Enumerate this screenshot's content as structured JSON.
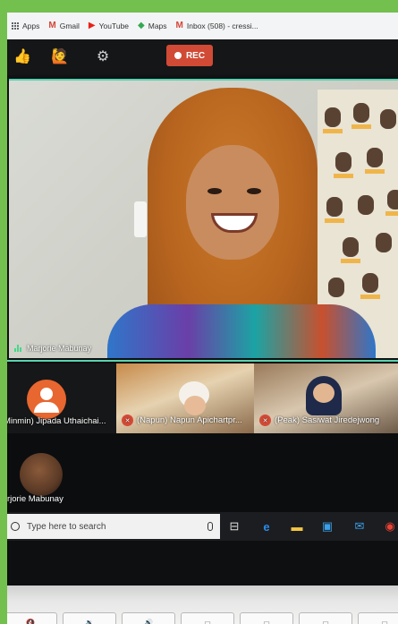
{
  "bookmarks": {
    "apps_label": "Apps",
    "items": [
      {
        "label": "Gmail",
        "icon": "gmail-icon",
        "glyph": "M",
        "color": "#d44638"
      },
      {
        "label": "YouTube",
        "icon": "youtube-icon",
        "glyph": "▶",
        "color": "#e62117"
      },
      {
        "label": "Maps",
        "icon": "maps-icon",
        "glyph": "◆",
        "color": "#34a853"
      },
      {
        "label": "Inbox (508) - cressi...",
        "icon": "gmail-icon",
        "glyph": "M",
        "color": "#d44638"
      }
    ]
  },
  "toolbar": {
    "rec_label": "REC",
    "colors": {
      "rec": "#d04a35",
      "accent": "#59d3b0"
    }
  },
  "main_video": {
    "speaker_name": "Marjorie Mabunay"
  },
  "gallery": [
    {
      "name": "Minmin) Jipada Uthaichai...",
      "type": "avatar",
      "muted": false
    },
    {
      "name": "(Napun) Napun Apichartpr...",
      "type": "video",
      "muted": true
    },
    {
      "name": "(Peak) Sasiwat Jiredejwong",
      "type": "video",
      "muted": true
    }
  ],
  "row2": {
    "name": "rjorie Mabunay"
  },
  "taskbar": {
    "search_placeholder": "Type here to search",
    "apps": [
      "task-view-icon",
      "edge-icon",
      "file-explorer-icon",
      "store-icon",
      "mail-icon",
      "chrome-icon"
    ]
  }
}
